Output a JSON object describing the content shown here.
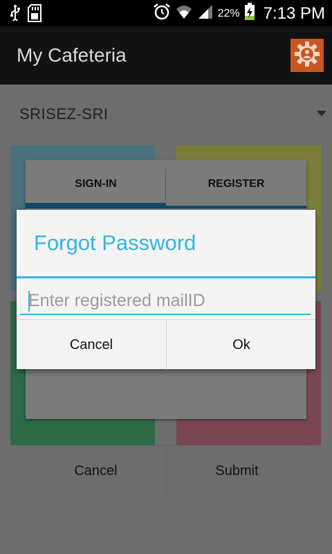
{
  "status_bar": {
    "battery": "22%",
    "time": "7:13 PM",
    "icons": [
      "usb-icon",
      "sd-card-icon",
      "alarm-icon",
      "wifi-icon",
      "signal-icon",
      "battery-charging-icon"
    ]
  },
  "action_bar": {
    "title": "My Cafeteria",
    "settings_icon": "gear-icon",
    "accent": "#c8581f"
  },
  "location_spinner": {
    "selected": "SRISEZ-SRI"
  },
  "tile_colors": {
    "blue": "#48707d",
    "yellow": "#7d7d3b",
    "green": "#2d6a48",
    "pink": "#7a4752"
  },
  "login_dialog": {
    "tabs": [
      {
        "label": "SIGN-IN",
        "selected": true
      },
      {
        "label": "REGISTER",
        "selected": false
      }
    ],
    "cancel_label": "Cancel",
    "submit_label": "Submit"
  },
  "forgot_password_dialog": {
    "title": "Forgot Password",
    "email_placeholder": "Enter registered mailID",
    "email_value": "",
    "cancel_label": "Cancel",
    "ok_label": "Ok",
    "accent": "#33b5e5"
  }
}
